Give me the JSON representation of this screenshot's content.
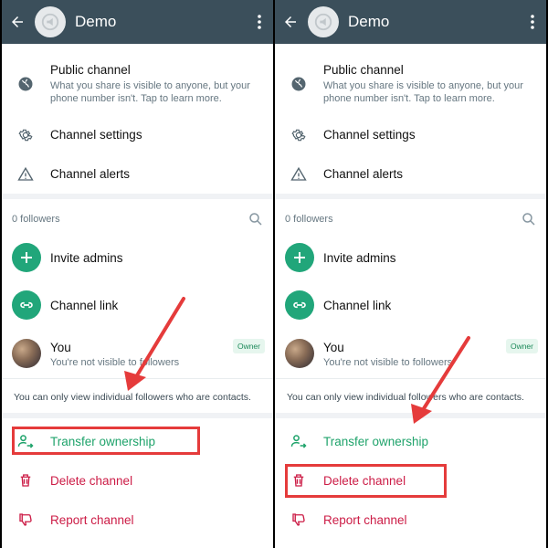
{
  "colors": {
    "header": "#3b4f5b",
    "accent_green": "#21a67a",
    "danger_red": "#cc1c46",
    "annotation_red": "#e53b3b"
  },
  "screens": [
    {
      "header": {
        "title": "Demo"
      },
      "info": {
        "public_channel": {
          "title": "Public channel",
          "description": "What you share is visible to anyone, but your phone number isn't. Tap to learn more."
        },
        "settings_label": "Channel settings",
        "alerts_label": "Channel alerts"
      },
      "followers": {
        "count_label": "0 followers",
        "invite_label": "Invite admins",
        "link_label": "Channel link",
        "user": {
          "name": "You",
          "subtitle": "You're not visible to followers",
          "badge": "Owner"
        },
        "note": "You can only view individual followers who are contacts."
      },
      "actions": {
        "transfer_label": "Transfer ownership",
        "delete_label": "Delete channel",
        "report_label": "Report channel"
      }
    },
    {
      "header": {
        "title": "Demo"
      },
      "info": {
        "public_channel": {
          "title": "Public channel",
          "description": "What you share is visible to anyone, but your phone number isn't. Tap to learn more."
        },
        "settings_label": "Channel settings",
        "alerts_label": "Channel alerts"
      },
      "followers": {
        "count_label": "0 followers",
        "invite_label": "Invite admins",
        "link_label": "Channel link",
        "user": {
          "name": "You",
          "subtitle": "You're not visible to followers",
          "badge": "Owner"
        },
        "note": "You can only view individual followers who are contacts."
      },
      "actions": {
        "transfer_label": "Transfer ownership",
        "delete_label": "Delete channel",
        "report_label": "Report channel"
      }
    }
  ]
}
